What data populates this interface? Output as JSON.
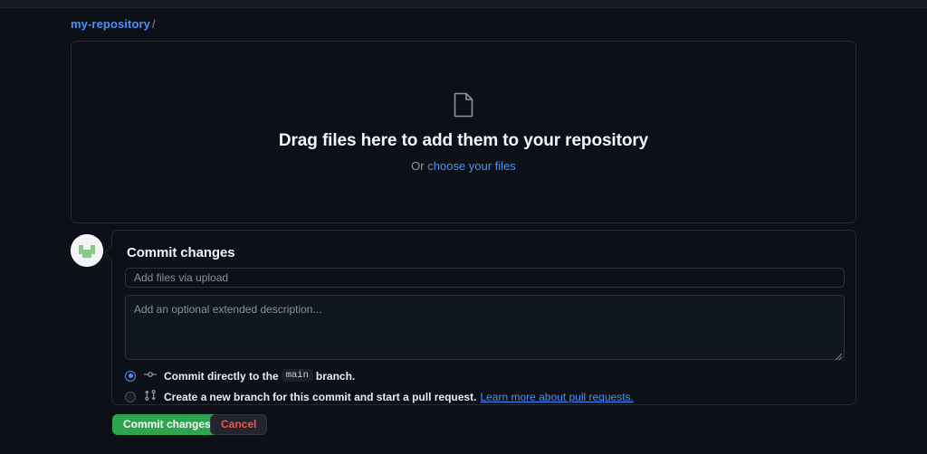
{
  "breadcrumb": {
    "repo": "my-repository",
    "separator": "/"
  },
  "dropzone": {
    "icon": "file-icon",
    "title": "Drag files here to add them to your repository",
    "or_text": "Or",
    "link_text": "choose your files"
  },
  "commit": {
    "avatar_name": "user-avatar",
    "heading": "Commit changes",
    "message_value": "",
    "message_placeholder": "Add files via upload",
    "description_value": "",
    "description_placeholder": "Add an optional extended description...",
    "options": [
      {
        "icon": "git-commit-icon",
        "selected": true,
        "text_before": "Commit directly to the",
        "branch": "main",
        "text_after": "branch."
      },
      {
        "icon": "git-pull-request-icon",
        "selected": false,
        "text_before": "Create a",
        "emphasis": "new branch",
        "text_after": "for this commit and start a pull request.",
        "link_text": "Learn more about pull requests."
      }
    ]
  },
  "actions": {
    "commit_label": "Commit changes",
    "cancel_label": "Cancel"
  },
  "colors": {
    "background": "#0d1117",
    "accent_blue": "#4493f8",
    "success_green": "#2da44e",
    "danger_red": "#f85149",
    "border": "#242b35",
    "muted_text": "#8b949e"
  }
}
